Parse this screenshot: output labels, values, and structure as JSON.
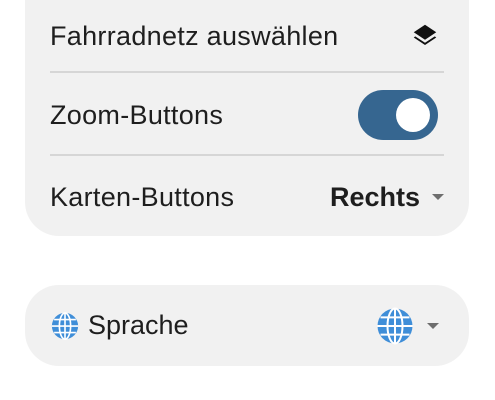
{
  "map_settings": {
    "bike_network": {
      "label": "Fahrradnetz auswählen",
      "icon": "layers-icon"
    },
    "zoom_buttons": {
      "label": "Zoom-Buttons",
      "enabled": true,
      "accent": "#366690"
    },
    "map_buttons": {
      "label": "Karten-Buttons",
      "selected": "Rechts"
    }
  },
  "language": {
    "label": "Sprache",
    "icon": "globe-icon",
    "selected_icon": "globe-icon"
  }
}
